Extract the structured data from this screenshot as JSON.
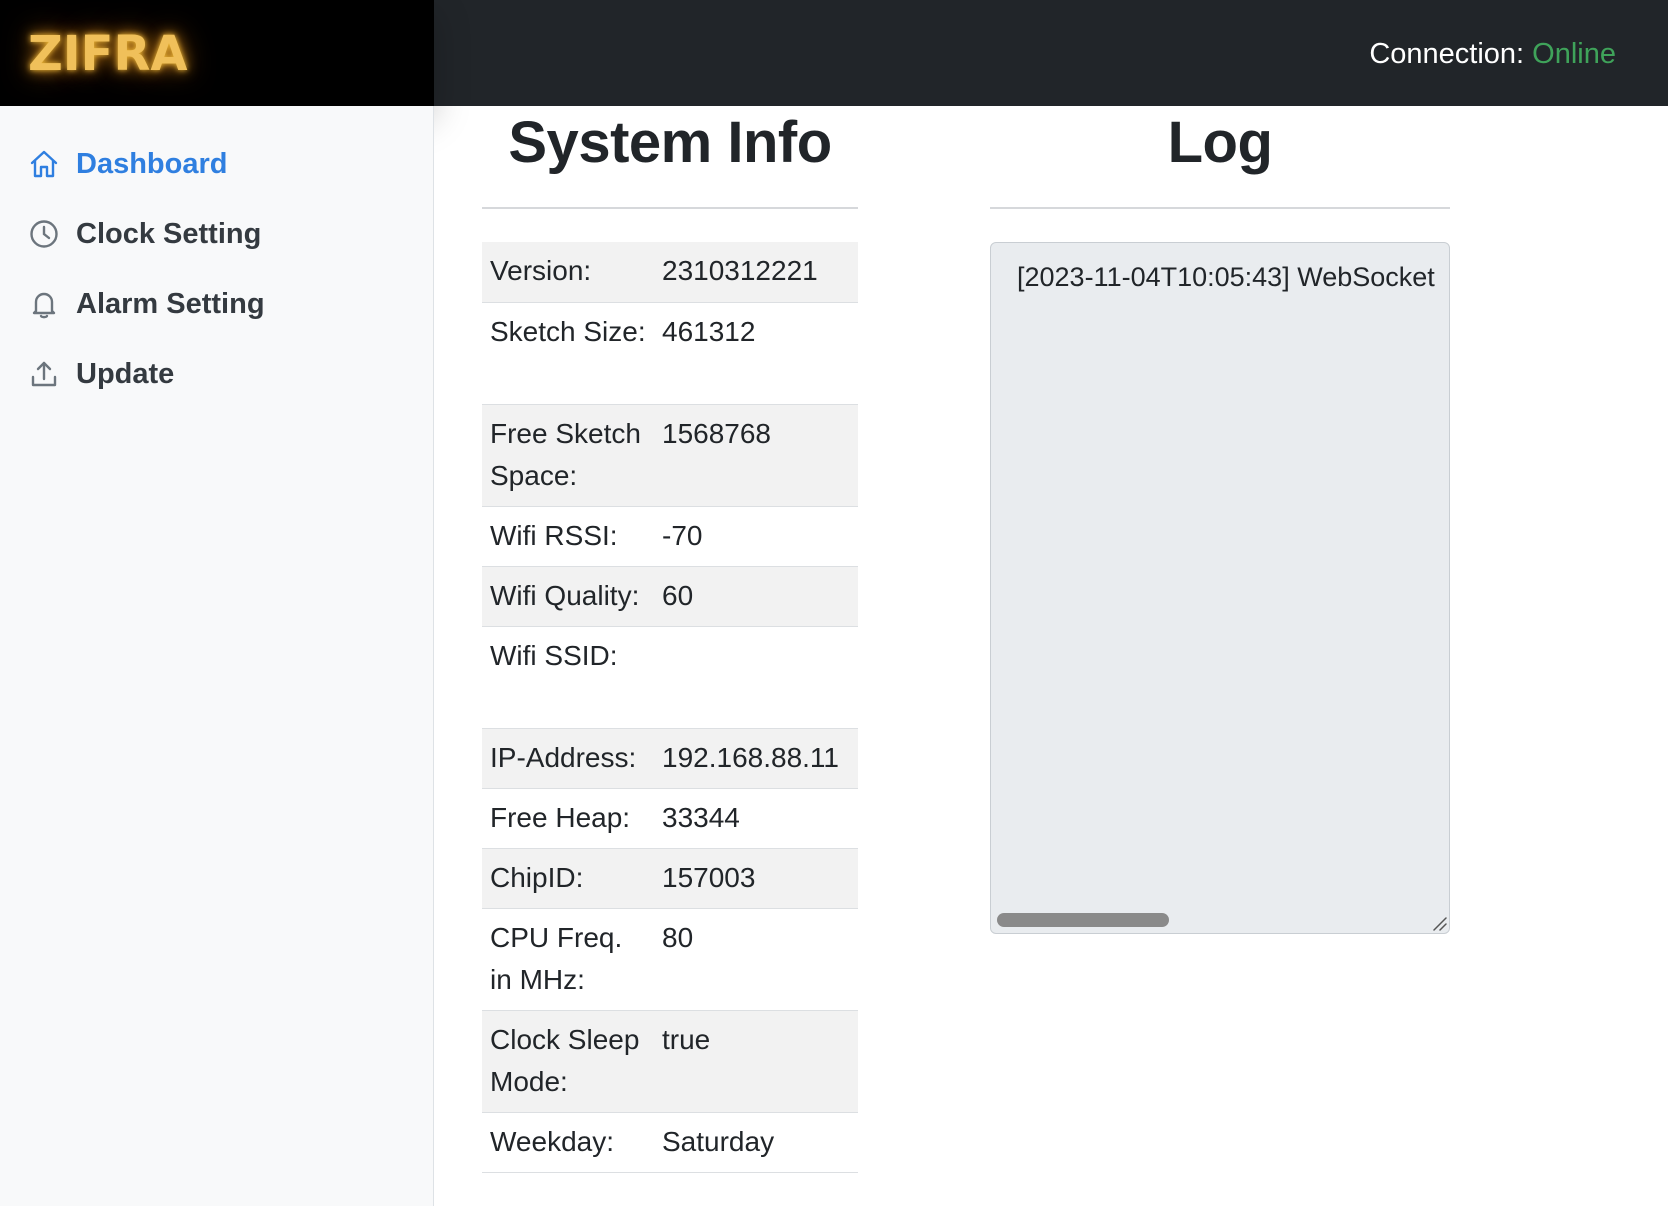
{
  "header": {
    "brand": "ZIFRA",
    "connection_label": "Connection:",
    "connection_status": "Online",
    "status_color": "#3fa35a",
    "brand_color": "#f0c05a"
  },
  "sidebar": {
    "items": [
      {
        "label": "Dashboard",
        "icon": "home-icon",
        "active": true
      },
      {
        "label": "Clock Setting",
        "icon": "clock-icon",
        "active": false
      },
      {
        "label": "Alarm Setting",
        "icon": "bell-icon",
        "active": false
      },
      {
        "label": "Update",
        "icon": "upload-icon",
        "active": false
      }
    ],
    "active_color": "#2f7fe0"
  },
  "system_info": {
    "title": "System Info",
    "rows": [
      {
        "key": "Version:",
        "value": "2310312221"
      },
      {
        "key": "Sketch Size:",
        "value": "461312"
      },
      {
        "key": "Free Sketch Space:",
        "value": "1568768"
      },
      {
        "key": "Wifi RSSI:",
        "value": "-70"
      },
      {
        "key": "Wifi Quality:",
        "value": "60"
      },
      {
        "key": "Wifi SSID:",
        "value": ""
      },
      {
        "key": "IP-Address:",
        "value": "192.168.88.11"
      },
      {
        "key": "Free Heap:",
        "value": "33344"
      },
      {
        "key": "ChipID:",
        "value": "157003"
      },
      {
        "key": "CPU Freq. in MHz:",
        "value": "80"
      },
      {
        "key": "Clock Sleep Mode:",
        "value": "true"
      },
      {
        "key": "Weekday:",
        "value": "Saturday"
      }
    ]
  },
  "log": {
    "title": "Log",
    "text": "[2023-11-04T10:05:43] WebSocket"
  }
}
